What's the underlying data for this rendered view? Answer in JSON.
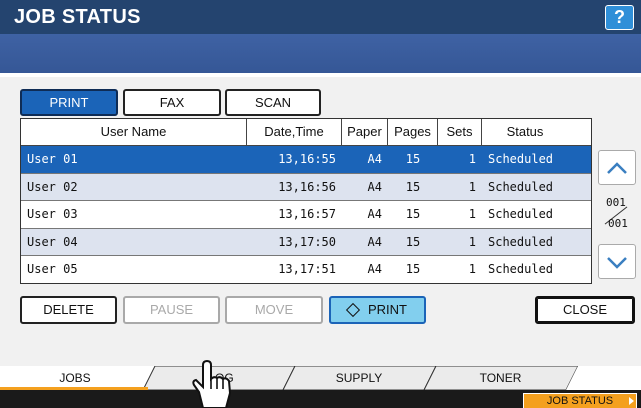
{
  "header": {
    "title": "JOB STATUS",
    "help_label": "?"
  },
  "type_tabs": [
    {
      "label": "PRINT",
      "selected": true
    },
    {
      "label": "FAX",
      "selected": false
    },
    {
      "label": "SCAN",
      "selected": false
    }
  ],
  "job_table": {
    "columns": [
      "User Name",
      "Date,Time",
      "Paper",
      "Pages",
      "Sets",
      "Status"
    ],
    "rows": [
      {
        "user": "User 01",
        "datetime": "13,16:55",
        "paper": "A4",
        "pages": "15",
        "sets": "1",
        "status": "Scheduled",
        "selected": true
      },
      {
        "user": "User 02",
        "datetime": "13,16:56",
        "paper": "A4",
        "pages": "15",
        "sets": "1",
        "status": "Scheduled"
      },
      {
        "user": "User 03",
        "datetime": "13,16:57",
        "paper": "A4",
        "pages": "15",
        "sets": "1",
        "status": "Scheduled"
      },
      {
        "user": "User 04",
        "datetime": "13,17:50",
        "paper": "A4",
        "pages": "15",
        "sets": "1",
        "status": "Scheduled"
      },
      {
        "user": "User 05",
        "datetime": "13,17:51",
        "paper": "A4",
        "pages": "15",
        "sets": "1",
        "status": "Scheduled"
      }
    ]
  },
  "pager": {
    "current": "001",
    "total": "001"
  },
  "actions": {
    "delete": "DELETE",
    "pause": "PAUSE",
    "move": "MOVE",
    "print": "PRINT",
    "close": "CLOSE"
  },
  "bottom_tabs": [
    {
      "label": "JOBS",
      "active": true
    },
    {
      "label": "LOG"
    },
    {
      "label": "SUPPLY"
    },
    {
      "label": "TONER"
    }
  ],
  "status_bar": {
    "job_status_label": "JOB STATUS"
  },
  "colors": {
    "title_bar": "#24446f",
    "selection": "#1b64b8",
    "print_button": "#82cfee",
    "active_tab_accent": "#f4a01e"
  }
}
